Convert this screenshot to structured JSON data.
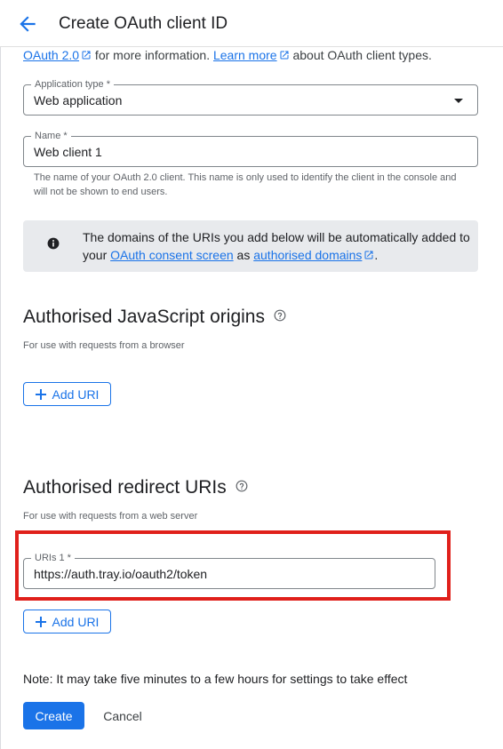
{
  "header": {
    "title": "Create OAuth client ID",
    "back_icon": "arrow-back-icon"
  },
  "intro": {
    "link1": "OAuth 2.0",
    "text1": " for more information. ",
    "link2": "Learn more",
    "text2": " about OAuth client types."
  },
  "application_type": {
    "label": "Application type *",
    "value": "Web application"
  },
  "name_field": {
    "label": "Name *",
    "value": "Web client 1",
    "hint": "The name of your OAuth 2.0 client. This name is only used to identify the client in the console and will not be shown to end users."
  },
  "info": {
    "text1": "The domains of the URIs you add below will be automatically added to your ",
    "link1": "OAuth consent screen",
    "text2": " as ",
    "link2": "authorised domains",
    "text3": "."
  },
  "js_origins": {
    "title": "Authorised JavaScript origins",
    "subtitle": "For use with requests from a browser",
    "add_label": "Add URI"
  },
  "redirect_uris": {
    "title": "Authorised redirect URIs",
    "subtitle": "For use with requests from a web server",
    "uri_label": "URIs 1 *",
    "uri_value": "https://auth.tray.io/oauth2/token",
    "add_label": "Add URI"
  },
  "note": "Note: It may take five minutes to a few hours for settings to take effect",
  "actions": {
    "create": "Create",
    "cancel": "Cancel"
  },
  "colors": {
    "accent": "#1a73e8",
    "highlight": "#e0201b",
    "info_bg": "#e8eaed"
  }
}
